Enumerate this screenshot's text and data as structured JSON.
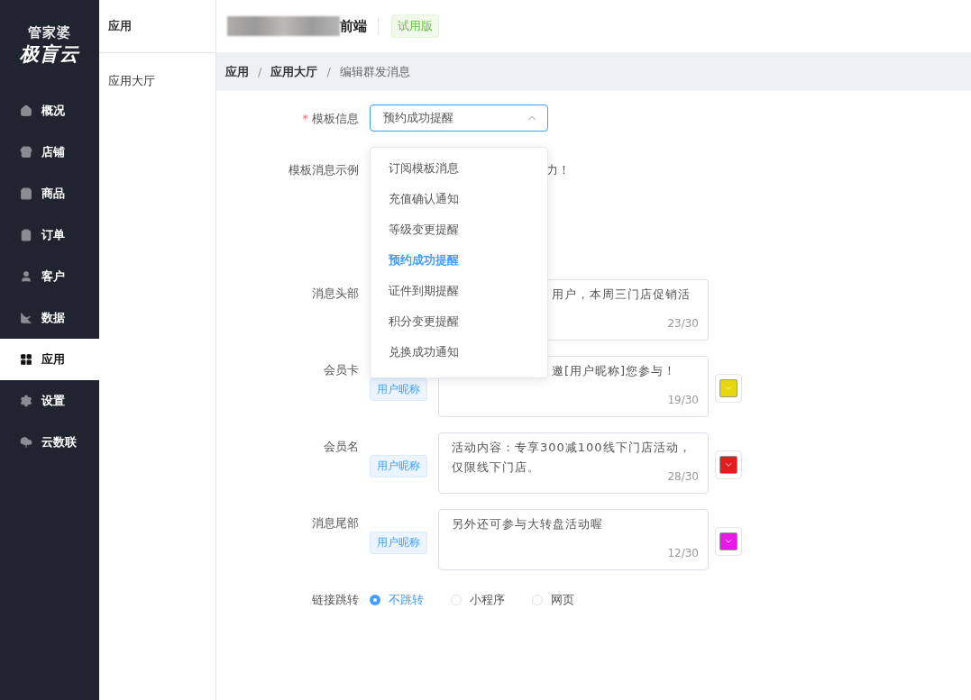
{
  "logo": {
    "line_1": "管家婆",
    "line_2": "极盲云"
  },
  "nav": [
    {
      "label": "概况",
      "selected": false
    },
    {
      "label": "店铺",
      "selected": false
    },
    {
      "label": "商品",
      "selected": false
    },
    {
      "label": "订单",
      "selected": false
    },
    {
      "label": "客户",
      "selected": false
    },
    {
      "label": "数据",
      "selected": false
    },
    {
      "label": "应用",
      "selected": true
    },
    {
      "label": "设置",
      "selected": false
    },
    {
      "label": "云数联",
      "selected": false
    }
  ],
  "subnav": {
    "title": "应用",
    "items": [
      {
        "label": "应用大厅",
        "selected": false
      }
    ]
  },
  "header": {
    "title": "前端",
    "badge": "试用版"
  },
  "breadcrumb": [
    {
      "label": "应用",
      "current": false
    },
    {
      "separator": "/",
      "label": "应用大厅",
      "current": false
    },
    {
      "separator": "/",
      "label": "编辑群发消息",
      "current": true
    }
  ],
  "form": {
    "template": {
      "label": "模板信息",
      "required_mark": "*",
      "value": "预约成功提醒",
      "expanded": true
    },
    "example": {
      "label": "模板消息示例",
      "text": "力！"
    },
    "fields": [
      {
        "label": "消息头部",
        "value": "用户，本周三门店促销活",
        "count": "23/30",
        "covered": true
      },
      {
        "label": "会员卡",
        "tag": "用户昵称",
        "value": "邀[用户昵称]您参与！",
        "count": "19/30",
        "covered": true,
        "color": "#e6d80a"
      },
      {
        "label": "会员名",
        "tag": "用户昵称",
        "value": "活动内容：专享300减100线下门店活动，仅限线下门店。",
        "count": "28/30",
        "covered": false,
        "color": "#e31c1c"
      },
      {
        "label": "消息尾部",
        "tag": "用户昵称",
        "value": "另外还可参与大转盘活动喔",
        "count": "12/30",
        "covered": false,
        "color": "#e619e6"
      }
    ],
    "link": {
      "label": "链接跳转",
      "options": [
        {
          "label": "不跳转",
          "selected": true
        },
        {
          "label": "小程序",
          "selected": false
        },
        {
          "label": "网页",
          "selected": false
        }
      ]
    }
  },
  "dropdown": [
    {
      "label": "订阅模板消息",
      "selected": false
    },
    {
      "label": "充值确认通知",
      "selected": false
    },
    {
      "label": "等级变更提醒",
      "selected": false
    },
    {
      "label": "预约成功提醒",
      "selected": true
    },
    {
      "label": "证件到期提醒",
      "selected": false
    },
    {
      "label": "积分变更提醒",
      "selected": false
    },
    {
      "label": "兑换成功通知",
      "selected": false
    }
  ]
}
